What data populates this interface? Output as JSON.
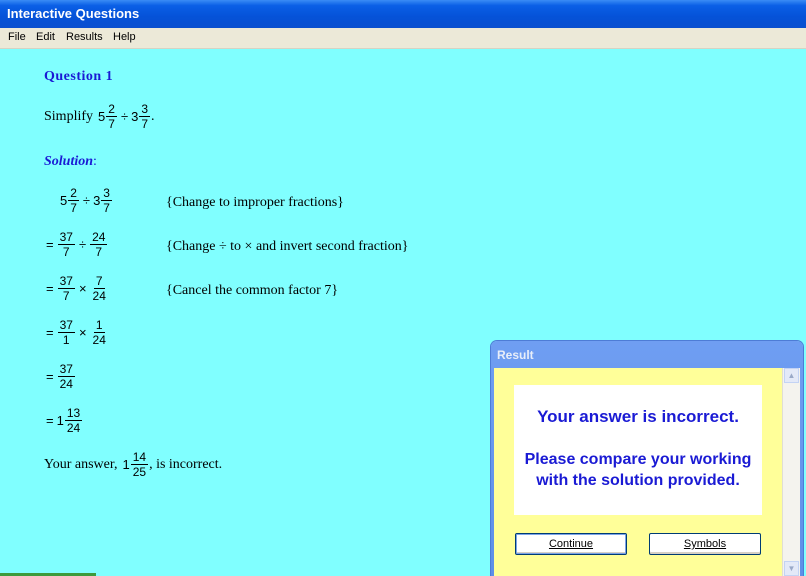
{
  "window": {
    "title": "Interactive Questions"
  },
  "menu": [
    "File",
    "Edit",
    "Results",
    "Help"
  ],
  "question": {
    "title": "Question 1",
    "prompt_prefix": "Simplify",
    "expr": {
      "w1": "5",
      "n1": "2",
      "d1": "7",
      "op": "÷",
      "w2": "3",
      "n2": "3",
      "d2": "7",
      "end": "."
    }
  },
  "solution": {
    "title": "Solution",
    "title_suffix": ":",
    "steps": [
      {
        "lead": "",
        "w1": "5",
        "n1": "2",
        "d1": "7",
        "op": "÷",
        "w2": "3",
        "n2": "3",
        "d2": "7",
        "note": "{Change to improper fractions}"
      },
      {
        "lead": "=",
        "n1": "37",
        "d1": "7",
        "op": "÷",
        "n2": "24",
        "d2": "7",
        "note": "{Change ÷ to × and invert second fraction}"
      },
      {
        "lead": "=",
        "n1": "37",
        "d1": "7",
        "op": "×",
        "n2": "7",
        "d2": "24",
        "note": "{Cancel the common factor 7}"
      },
      {
        "lead": "=",
        "n1": "37",
        "d1": "1",
        "op": "×",
        "n2": "1",
        "d2": "24"
      },
      {
        "lead": "=",
        "n1": "37",
        "d1": "24"
      },
      {
        "lead": "=",
        "w1": "1",
        "n1": "13",
        "d1": "24"
      }
    ],
    "answer_prefix": "Your answer,",
    "answer": {
      "w": "1",
      "n": "14",
      "d": "25"
    },
    "answer_suffix": ", is incorrect."
  },
  "dialog": {
    "title": "Result",
    "message1": "Your answer is incorrect.",
    "message2": "Please compare your working with the solution provided.",
    "continue_label": "Continue",
    "symbols_label": "Symbols"
  }
}
